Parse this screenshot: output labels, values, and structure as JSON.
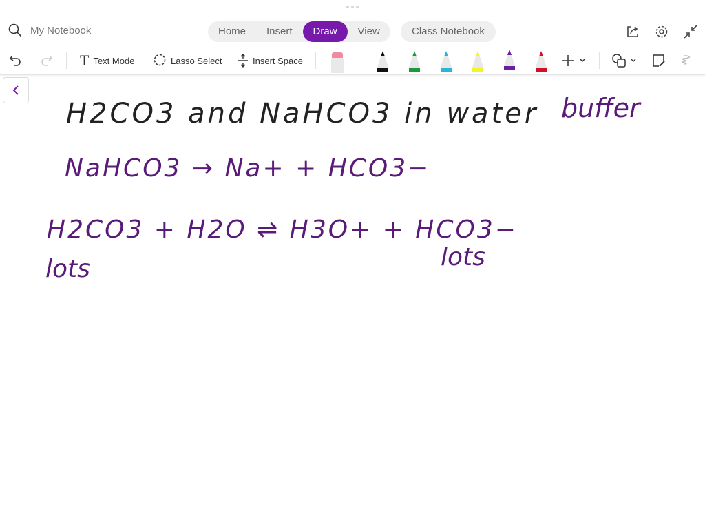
{
  "header": {
    "notebook_name": "My Notebook",
    "tabs": [
      {
        "label": "Home"
      },
      {
        "label": "Insert"
      },
      {
        "label": "Draw",
        "active": true
      },
      {
        "label": "View"
      }
    ],
    "extra_tab": "Class Notebook"
  },
  "toolbar": {
    "text_mode": "Text Mode",
    "lasso_select": "Lasso Select",
    "insert_space": "Insert Space",
    "pens": [
      {
        "name": "black",
        "color": "#111111"
      },
      {
        "name": "green",
        "color": "#1a9a3a"
      },
      {
        "name": "cyan",
        "color": "#2ab5d8"
      },
      {
        "name": "yellow-highlighter",
        "color": "#f2f52a"
      },
      {
        "name": "purple",
        "color": "#6a1fa0",
        "selected": true
      },
      {
        "name": "red",
        "color": "#d0102a"
      }
    ]
  },
  "ink": {
    "color": "#5a1a7a",
    "lines": [
      "H2CO3 and NaHCO3 in water",
      "buffer",
      "NaHCO3 → Na+ + HCO3−",
      "H2CO3 + H2O ⇌ H3O+ + HCO3−",
      "lots",
      "lots"
    ]
  }
}
